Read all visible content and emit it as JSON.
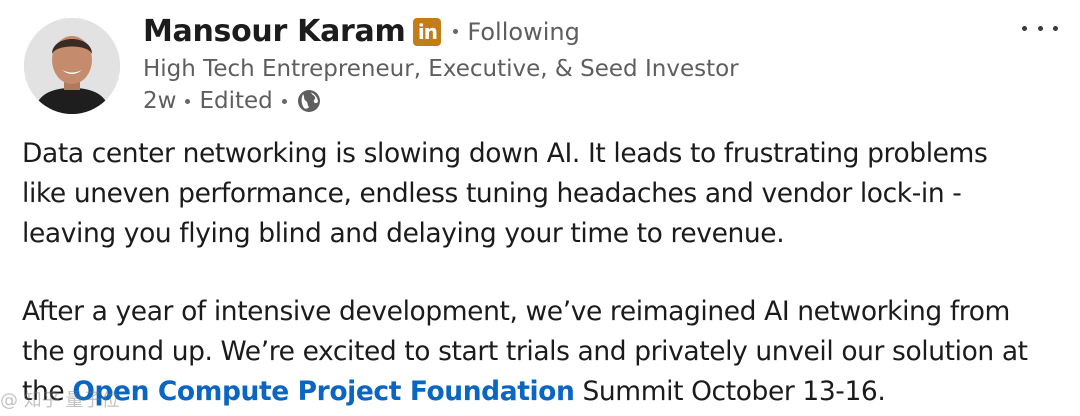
{
  "post": {
    "author": {
      "name": "Mansour Karam",
      "badge_text": "in",
      "following_label": "Following",
      "headline": "High Tech Entrepreneur, Executive, & Seed Investor"
    },
    "meta": {
      "age": "2w",
      "edited_label": "Edited",
      "visibility_icon": "globe-icon"
    },
    "body": {
      "line1": "Data center networking is slowing down AI. It leads to frustrating problems",
      "line2": "like uneven performance, endless tuning headaches and vendor lock-in -",
      "line3": "leaving you flying blind and delaying your time to revenue.",
      "line4": "After a year of intensive development, we’ve reimagined AI networking from",
      "line5": "the ground up. We’re excited to start trials and privately unveil our solution at",
      "line6_prefix": "the ",
      "mention": "Open Compute Project Foundation",
      "line6_suffix": " Summit October 13-16."
    },
    "watermark": "@ 知乎 量子位"
  },
  "colors": {
    "badge": "#c37d16",
    "mention": "#0a66c2",
    "muted": "#5e5e5e"
  }
}
